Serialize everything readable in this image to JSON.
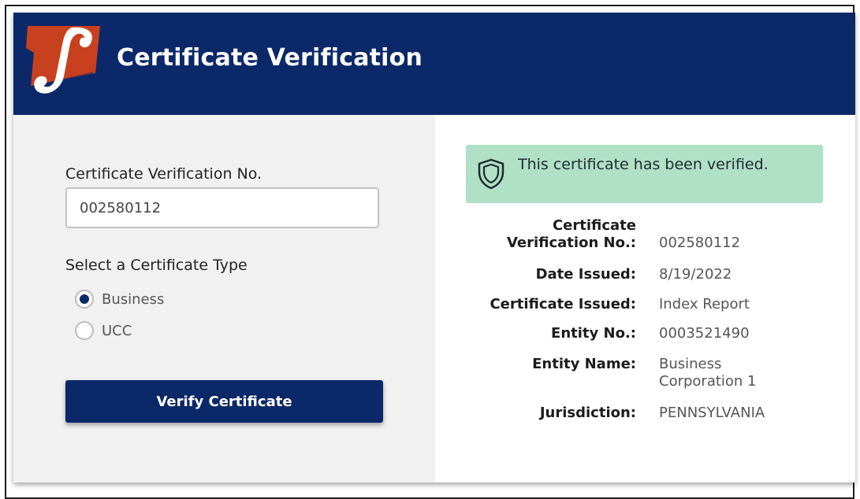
{
  "header": {
    "title": "Certificate Verification",
    "logo_icon": "pa-keystone-logo-icon",
    "background_color": "#0b2868"
  },
  "form": {
    "cert_no_label": "Certificate Verification No.",
    "cert_no_value": "002580112",
    "type_label": "Select a Certificate Type",
    "options": [
      {
        "label": "Business",
        "selected": true
      },
      {
        "label": "UCC",
        "selected": false
      }
    ],
    "verify_button": "Verify Certificate"
  },
  "result": {
    "alert_icon": "shield-icon",
    "alert_text": "This certificate has been verified.",
    "alert_color": "#b0e0c6",
    "details": [
      {
        "label": "Certificate Verification No.:",
        "value": "002580112"
      },
      {
        "label": "Date Issued:",
        "value": "8/19/2022"
      },
      {
        "label": "Certificate Issued:",
        "value": "Index Report"
      },
      {
        "label": "Entity No.:",
        "value": "0003521490"
      },
      {
        "label": "Entity Name:",
        "value": "Business Corporation 1"
      },
      {
        "label": "Jurisdiction:",
        "value": "PENNSYLVANIA"
      }
    ]
  }
}
